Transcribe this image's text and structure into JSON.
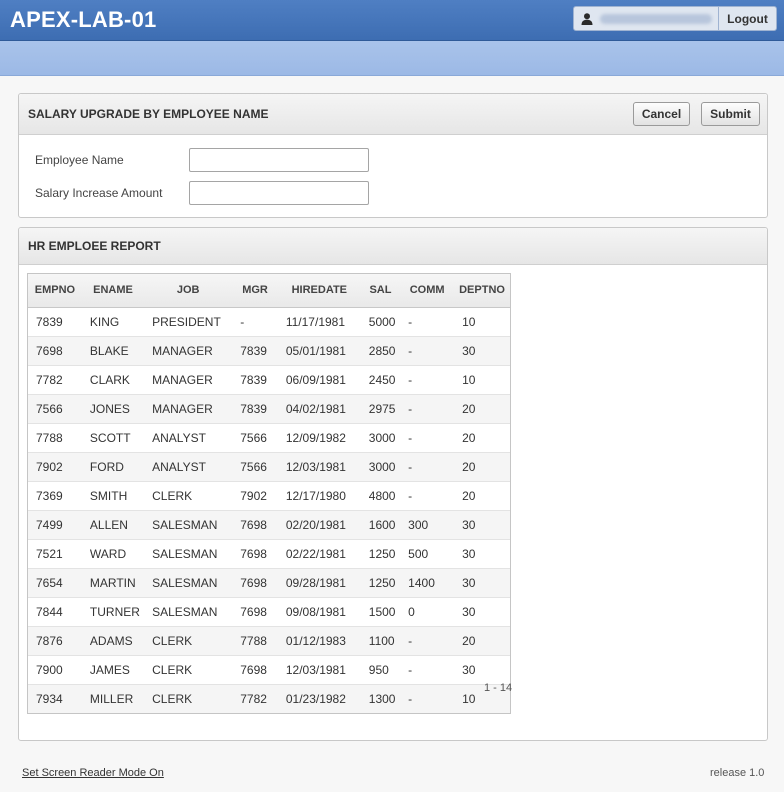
{
  "app": {
    "title": "APEX-LAB-01",
    "logout_label": "Logout"
  },
  "form_region": {
    "title": "SALARY UPGRADE BY EMPLOYEE NAME",
    "cancel_label": "Cancel",
    "submit_label": "Submit",
    "fields": [
      {
        "label": "Employee Name",
        "value": ""
      },
      {
        "label": "Salary Increase Amount",
        "value": ""
      }
    ]
  },
  "report_region": {
    "title": "HR EMPLOEE REPORT",
    "columns": [
      "EMPNO",
      "ENAME",
      "JOB",
      "MGR",
      "HIREDATE",
      "SAL",
      "COMM",
      "DEPTNO"
    ],
    "rows": [
      [
        "7839",
        "KING",
        "PRESIDENT",
        "-",
        "11/17/1981",
        "5000",
        "-",
        "10"
      ],
      [
        "7698",
        "BLAKE",
        "MANAGER",
        "7839",
        "05/01/1981",
        "2850",
        "-",
        "30"
      ],
      [
        "7782",
        "CLARK",
        "MANAGER",
        "7839",
        "06/09/1981",
        "2450",
        "-",
        "10"
      ],
      [
        "7566",
        "JONES",
        "MANAGER",
        "7839",
        "04/02/1981",
        "2975",
        "-",
        "20"
      ],
      [
        "7788",
        "SCOTT",
        "ANALYST",
        "7566",
        "12/09/1982",
        "3000",
        "-",
        "20"
      ],
      [
        "7902",
        "FORD",
        "ANALYST",
        "7566",
        "12/03/1981",
        "3000",
        "-",
        "20"
      ],
      [
        "7369",
        "SMITH",
        "CLERK",
        "7902",
        "12/17/1980",
        "4800",
        "-",
        "20"
      ],
      [
        "7499",
        "ALLEN",
        "SALESMAN",
        "7698",
        "02/20/1981",
        "1600",
        "300",
        "30"
      ],
      [
        "7521",
        "WARD",
        "SALESMAN",
        "7698",
        "02/22/1981",
        "1250",
        "500",
        "30"
      ],
      [
        "7654",
        "MARTIN",
        "SALESMAN",
        "7698",
        "09/28/1981",
        "1250",
        "1400",
        "30"
      ],
      [
        "7844",
        "TURNER",
        "SALESMAN",
        "7698",
        "09/08/1981",
        "1500",
        "0",
        "30"
      ],
      [
        "7876",
        "ADAMS",
        "CLERK",
        "7788",
        "01/12/1983",
        "1100",
        "-",
        "20"
      ],
      [
        "7900",
        "JAMES",
        "CLERK",
        "7698",
        "12/03/1981",
        "950",
        "-",
        "30"
      ],
      [
        "7934",
        "MILLER",
        "CLERK",
        "7782",
        "01/23/1982",
        "1300",
        "-",
        "10"
      ]
    ],
    "pagination": "1 - 14"
  },
  "footer": {
    "screen_reader_link": "Set Screen Reader Mode On",
    "release": "release 1.0"
  },
  "icons": {
    "user": "user-icon"
  },
  "colors": {
    "header_blue": "#4575bb",
    "subbar_blue": "#a3bfe8"
  }
}
